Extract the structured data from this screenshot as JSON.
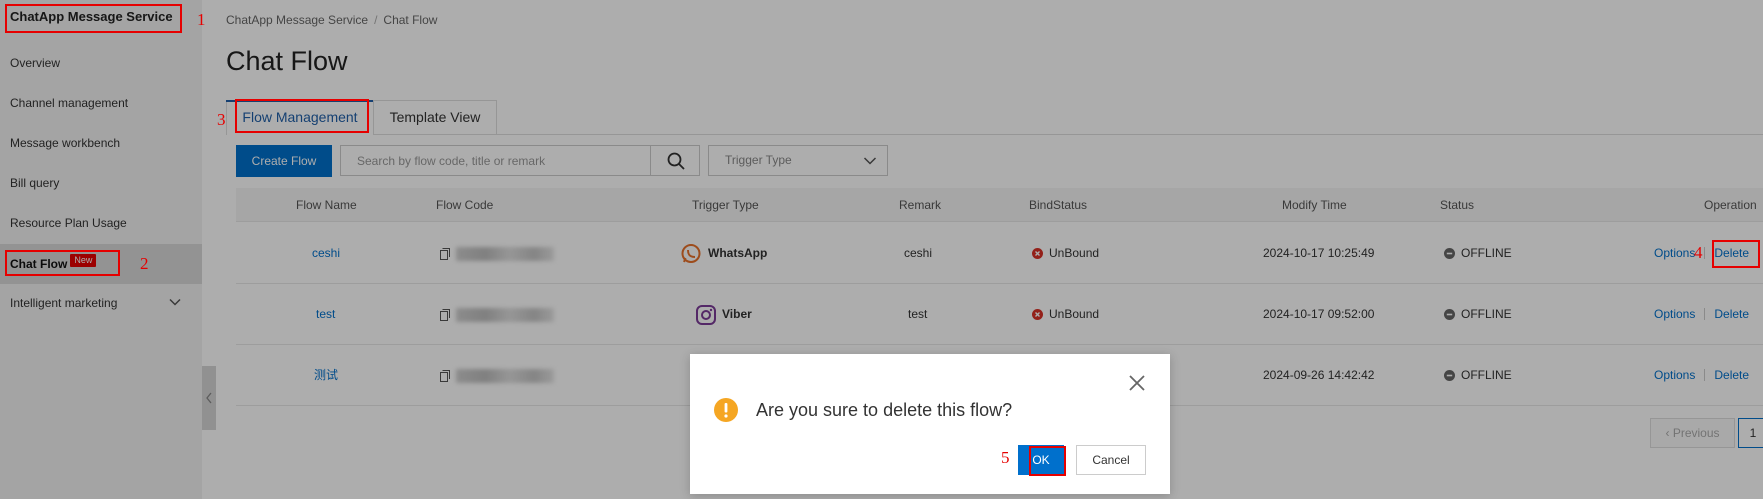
{
  "sidebar": {
    "title": "ChatApp Message Service",
    "items": [
      {
        "label": "Overview"
      },
      {
        "label": "Channel management"
      },
      {
        "label": "Message workbench"
      },
      {
        "label": "Bill query"
      },
      {
        "label": "Resource Plan Usage"
      },
      {
        "label": "Chat Flow",
        "badge": "New",
        "active": true
      },
      {
        "label": "Intelligent marketing",
        "expandable": true
      }
    ]
  },
  "breadcrumb": {
    "root": "ChatApp Message Service",
    "separator": "/",
    "current": "Chat Flow"
  },
  "page_title": "Chat Flow",
  "tabs": [
    {
      "label": "Flow Management",
      "active": true
    },
    {
      "label": "Template View",
      "active": false
    }
  ],
  "toolbar": {
    "create_label": "Create Flow",
    "search_placeholder": "Search by flow code, title or remark",
    "trigger_placeholder": "Trigger Type"
  },
  "table": {
    "columns": [
      "Flow Name",
      "Flow Code",
      "Trigger Type",
      "Remark",
      "BindStatus",
      "Modify Time",
      "Status",
      "Operation"
    ],
    "rows": [
      {
        "name": "ceshi",
        "trigger": "WhatsApp",
        "trigger_icon": "whatsapp-icon",
        "remark": "ceshi",
        "bind_status": "UnBound",
        "modify_time": "2024-10-17 10:25:49",
        "status": "OFFLINE",
        "op_options": "Options",
        "op_delete": "Delete"
      },
      {
        "name": "test",
        "trigger": "Viber",
        "trigger_icon": "viber-icon",
        "remark": "test",
        "bind_status": "UnBound",
        "modify_time": "2024-10-17 09:52:00",
        "status": "OFFLINE",
        "op_options": "Options",
        "op_delete": "Delete"
      },
      {
        "name": "测试",
        "trigger": "",
        "trigger_icon": "",
        "remark": "",
        "bind_status": "",
        "modify_time": "2024-09-26 14:42:42",
        "status": "OFFLINE",
        "op_options": "Options",
        "op_delete": "Delete"
      }
    ]
  },
  "pagination": {
    "prev_label": "Previous",
    "current_page": "1"
  },
  "dialog": {
    "message": "Are you sure to delete this flow?",
    "ok_label": "OK",
    "cancel_label": "Cancel"
  },
  "annotations": [
    "1",
    "2",
    "3",
    "4",
    "5"
  ],
  "colors": {
    "primary": "#0070cc",
    "annotation": "#e60000",
    "unbound": "#d93026",
    "offline": "#666666",
    "warning": "#f5a623"
  }
}
